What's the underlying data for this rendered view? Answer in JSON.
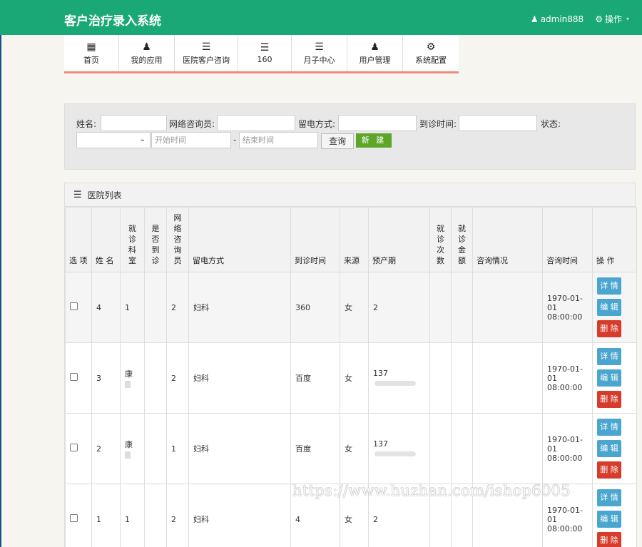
{
  "app": {
    "title": "客户治疗录入系统",
    "user": "admin888",
    "ops_label": "操作"
  },
  "nav": [
    {
      "label": "首页",
      "icon": "▦"
    },
    {
      "label": "我的应用",
      "icon": "♟"
    },
    {
      "label": "医院客户咨询",
      "icon": "☰"
    },
    {
      "label": "160",
      "icon": "☰"
    },
    {
      "label": "月子中心",
      "icon": "☰"
    },
    {
      "label": "用户管理",
      "icon": "♟"
    },
    {
      "label": "系统配置",
      "icon": "⚙"
    }
  ],
  "search": {
    "name_label": "姓名:",
    "consultant_label": "网络咨询员:",
    "contact_label": "留电方式:",
    "visit_time_label": "到诊时间:",
    "status_label": "状态:",
    "start_placeholder": "开始时间",
    "end_placeholder": "结束时间",
    "separator": "-",
    "query_button": "查询",
    "new_button": "新 建"
  },
  "table": {
    "title": "医院列表",
    "headers": {
      "select": "选 项",
      "name": "姓 名",
      "dept": [
        "就",
        "诊",
        "科",
        "室"
      ],
      "arrived": [
        "是",
        "否",
        "到",
        "诊"
      ],
      "consultant": [
        "网",
        "络",
        "咨",
        "询",
        "员"
      ],
      "contact": "留电方式",
      "visit_time": "到诊时间",
      "source": "来源",
      "due": "预产期",
      "visits": [
        "就",
        "诊",
        "次",
        "数"
      ],
      "amount": [
        "就",
        "诊",
        "金",
        "额"
      ],
      "consult_info": "咨询情况",
      "consult_time": "咨询时间",
      "ops": "操 作"
    },
    "rows": [
      {
        "name": "4",
        "dept": "1",
        "dept_blur": false,
        "arrived": "",
        "consultant": "2",
        "contact": "妇科",
        "visit_time": "360",
        "source": "女",
        "due": "2",
        "due_blur": false,
        "time1": "1970-01-",
        "time2": "01",
        "time3": "08:00:00"
      },
      {
        "name": "3",
        "dept": "康",
        "dept_blur": true,
        "arrived": "",
        "consultant": "2",
        "contact": "妇科",
        "visit_time": "百度",
        "source": "女",
        "due": "137",
        "due_blur": true,
        "time1": "1970-01-",
        "time2": "01",
        "time3": "08:00:00"
      },
      {
        "name": "2",
        "dept": "康",
        "dept_blur": true,
        "arrived": "",
        "consultant": "1",
        "contact": "妇科",
        "visit_time": "百度",
        "source": "女",
        "due": "137",
        "due_blur": true,
        "time1": "1970-01-",
        "time2": "01",
        "time3": "08:00:00"
      },
      {
        "name": "1",
        "dept": "1",
        "dept_blur": false,
        "arrived": "",
        "consultant": "2",
        "contact": "妇科",
        "visit_time": "4",
        "source": "女",
        "due": "2",
        "due_blur": false,
        "time1": "1970-01-",
        "time2": "01",
        "time3": "08:00:00"
      }
    ],
    "actions": {
      "detail": "详 情",
      "edit": "编 辑",
      "delete": "删 除"
    }
  },
  "watermark": "https://www.huzhan.com/ishop6005",
  "colors": {
    "header": "#1aa877",
    "nav_underline": "#f08a7e",
    "new_button": "#5ea62a",
    "info_button": "#4aa6cf",
    "delete_button": "#d63b2b"
  }
}
